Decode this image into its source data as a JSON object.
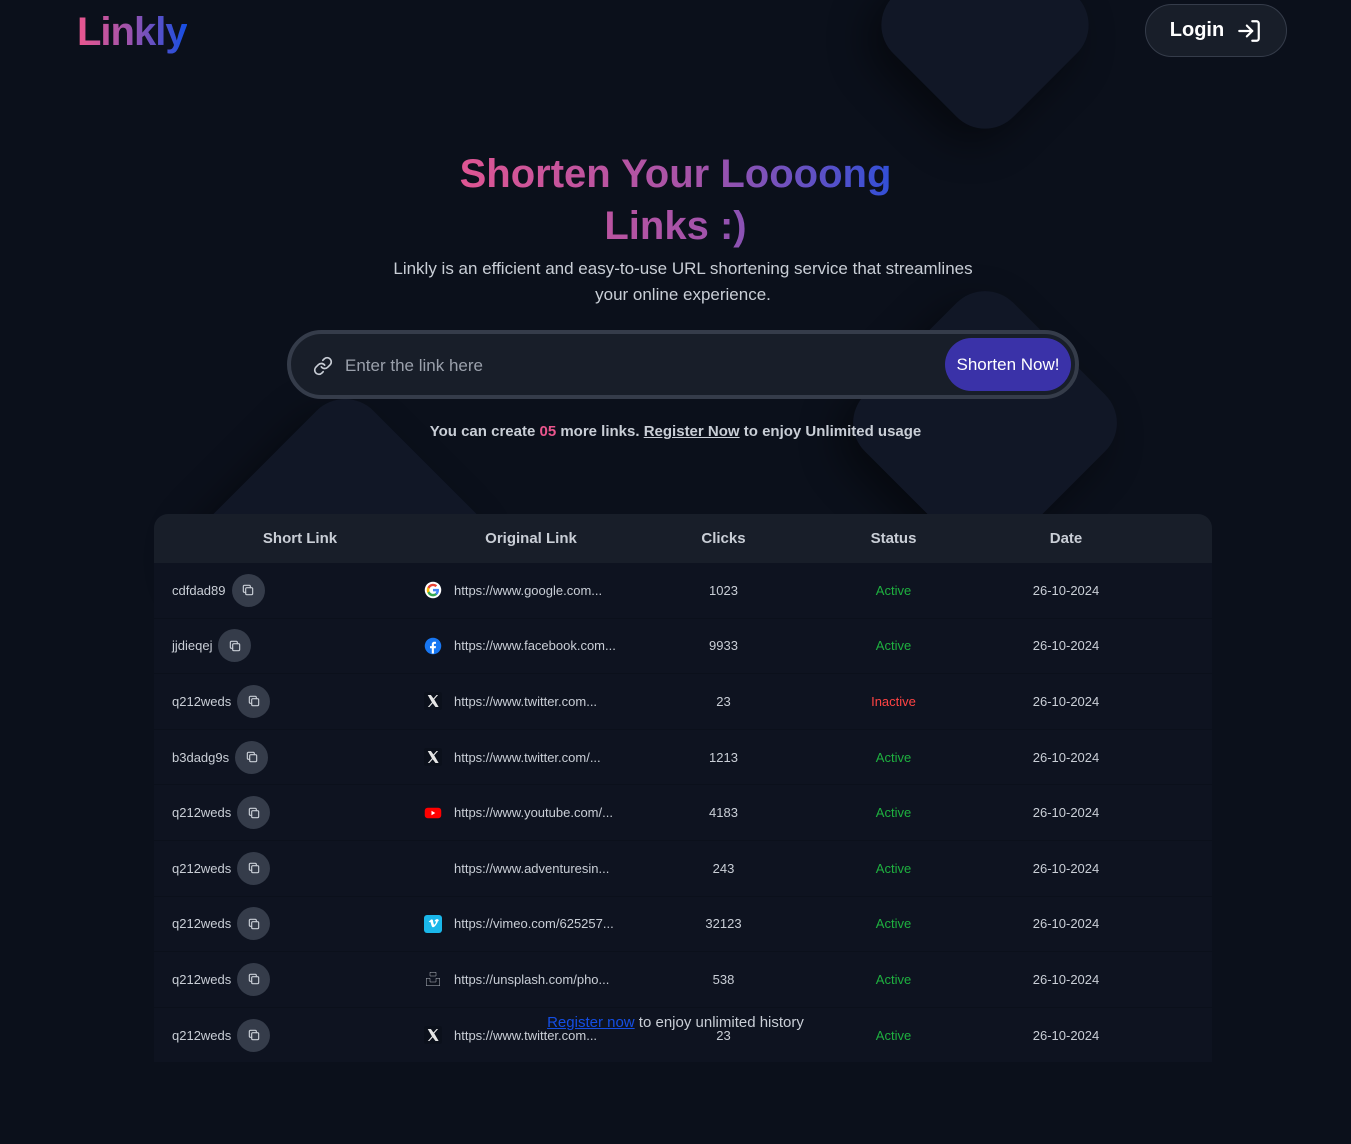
{
  "header": {
    "logo": "Linkly",
    "login_label": "Login"
  },
  "hero": {
    "title": "Shorten Your Loooong Links :)",
    "subtitle": "Linkly is an efficient and easy-to-use URL shortening service that streamlines your online experience."
  },
  "search": {
    "placeholder": "Enter the link here",
    "button_label": "Shorten Now!"
  },
  "notice": {
    "pre": "You can create ",
    "count": "05",
    "mid": " more links. ",
    "link": "Register Now",
    "post": " to enjoy Unlimited usage"
  },
  "table": {
    "headers": [
      "Short Link",
      "Original Link",
      "Clicks",
      "Status",
      "Date"
    ],
    "rows": [
      {
        "short": "cdfdad89",
        "icon": "google-icon",
        "url": "https://www.google.com...",
        "clicks": "1023",
        "status": "Active",
        "date": "26-10-2024"
      },
      {
        "short": "jjdieqej",
        "icon": "facebook-icon",
        "url": "https://www.facebook.com...",
        "clicks": "9933",
        "status": "Active",
        "date": "26-10-2024"
      },
      {
        "short": "q212weds",
        "icon": "x-icon",
        "url": "https://www.twitter.com...",
        "clicks": "23",
        "status": "Inactive",
        "date": "26-10-2024"
      },
      {
        "short": "b3dadg9s",
        "icon": "x-icon",
        "url": "https://www.twitter.com/...",
        "clicks": "1213",
        "status": "Active",
        "date": "26-10-2024"
      },
      {
        "short": "q212weds",
        "icon": "youtube-icon",
        "url": "https://www.youtube.com/...",
        "clicks": "4183",
        "status": "Active",
        "date": "26-10-2024"
      },
      {
        "short": "q212weds",
        "icon": "",
        "url": "https://www.adventuresin...",
        "clicks": "243",
        "status": "Active",
        "date": "26-10-2024"
      },
      {
        "short": "q212weds",
        "icon": "vimeo-icon",
        "url": "https://vimeo.com/625257...",
        "clicks": "32123",
        "status": "Active",
        "date": "26-10-2024"
      },
      {
        "short": "q212weds",
        "icon": "unsplash-icon",
        "url": "https://unsplash.com/pho...",
        "clicks": "538",
        "status": "Active",
        "date": "26-10-2024"
      },
      {
        "short": "q212weds",
        "icon": "x-icon",
        "url": "https://www.twitter.com...",
        "clicks": "23",
        "status": "Active",
        "date": "26-10-2024"
      }
    ]
  },
  "footer_overlay": {
    "link": "Register now",
    "text": " to enjoy unlimited history"
  },
  "colors": {
    "background": "#0b101b",
    "accent_pink": "#eb568e",
    "accent_blue": "#144ee3",
    "button": "#3a32a8",
    "active": "#1eb03f",
    "inactive": "#ff4343"
  }
}
